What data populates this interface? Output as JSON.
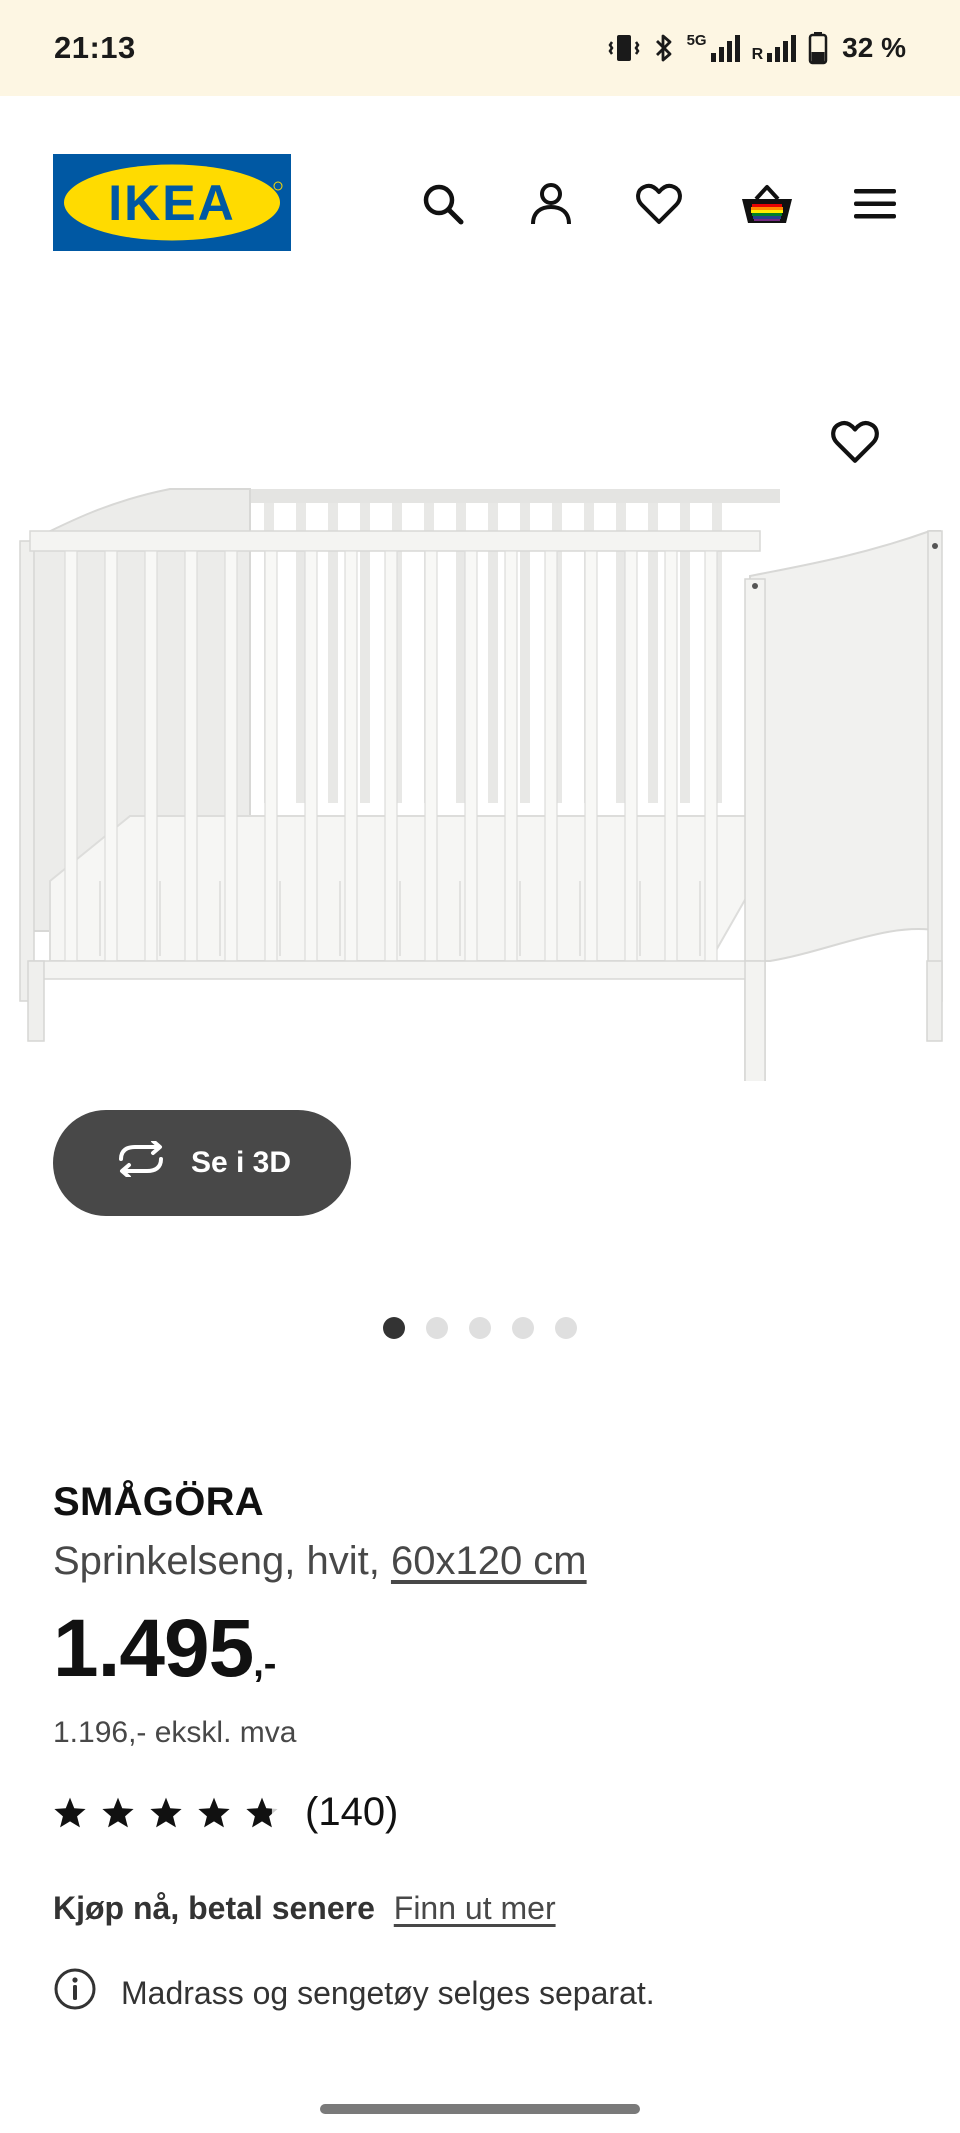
{
  "status_bar": {
    "time": "21:13",
    "network_label": "5G",
    "roaming_label": "R",
    "battery_percent": "32 %"
  },
  "header": {
    "logo_text": "IKEA",
    "icons": [
      "search-icon",
      "profile-icon",
      "heart-icon",
      "cart-icon",
      "menu-icon"
    ]
  },
  "gallery": {
    "view_3d_label": "Se i 3D",
    "slide_count": 5,
    "active_slide": 1
  },
  "product": {
    "name": "SMÅGÖRA",
    "description": "Sprinkelseng, hvit, ",
    "size": "60x120 cm",
    "price_main": "1.495",
    "price_suffix": ",-",
    "price_ex_vat": "1.196,- ekskl. mva",
    "rating_value": 4.8,
    "rating_max": 5,
    "rating_count": "(140)"
  },
  "payment": {
    "label": "Kjøp nå, betal senere",
    "link": "Finn ut mer"
  },
  "notice": {
    "text": "Madrass og sengetøy selges separat."
  },
  "colors": {
    "ikea_blue": "#0058a3",
    "ikea_yellow": "#ffdb00",
    "status_bar_bg": "#fdf6e3",
    "button_dark": "#484848"
  }
}
